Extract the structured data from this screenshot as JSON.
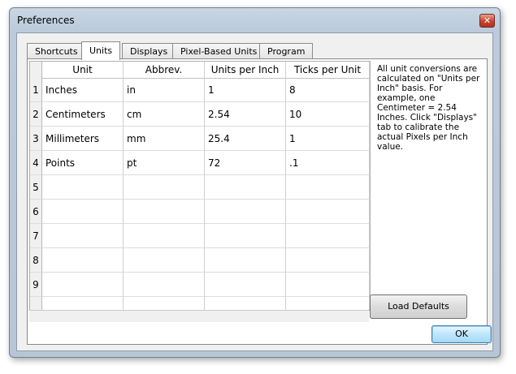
{
  "window": {
    "title": "Preferences",
    "close_glyph": "✕"
  },
  "tabs": [
    {
      "label": "Shortcuts",
      "active": false
    },
    {
      "label": "Units",
      "active": true
    },
    {
      "label": "Displays",
      "active": false
    },
    {
      "label": "Pixel-Based Units",
      "active": false
    },
    {
      "label": "Program",
      "active": false
    }
  ],
  "grid": {
    "headers": [
      "Unit",
      "Abbrev.",
      "Units per Inch",
      "Ticks per Unit"
    ],
    "rows": [
      {
        "num": "1",
        "unit": "Inches",
        "abbrev": "in",
        "units_per_inch": "1",
        "ticks_per_unit": "8"
      },
      {
        "num": "2",
        "unit": "Centimeters",
        "abbrev": "cm",
        "units_per_inch": "2.54",
        "ticks_per_unit": "10"
      },
      {
        "num": "3",
        "unit": "Millimeters",
        "abbrev": "mm",
        "units_per_inch": "25.4",
        "ticks_per_unit": "1"
      },
      {
        "num": "4",
        "unit": "Points",
        "abbrev": "pt",
        "units_per_inch": "72",
        "ticks_per_unit": ".1"
      },
      {
        "num": "5",
        "unit": "",
        "abbrev": "",
        "units_per_inch": "",
        "ticks_per_unit": ""
      },
      {
        "num": "6",
        "unit": "",
        "abbrev": "",
        "units_per_inch": "",
        "ticks_per_unit": ""
      },
      {
        "num": "7",
        "unit": "",
        "abbrev": "",
        "units_per_inch": "",
        "ticks_per_unit": ""
      },
      {
        "num": "8",
        "unit": "",
        "abbrev": "",
        "units_per_inch": "",
        "ticks_per_unit": ""
      },
      {
        "num": "9",
        "unit": "",
        "abbrev": "",
        "units_per_inch": "",
        "ticks_per_unit": ""
      }
    ]
  },
  "note": "All unit conversions are calculated on \"Units per Inch\" basis. For example, one Centimeter = 2.54 Inches. Click \"Displays\" tab to calibrate the actual Pixels per Inch value.",
  "buttons": {
    "load_defaults": "Load Defaults",
    "ok": "OK"
  },
  "colors": {
    "title_bar": "#bccbdb",
    "close_button": "#c7412d",
    "ok_button": "#bee6fd"
  }
}
